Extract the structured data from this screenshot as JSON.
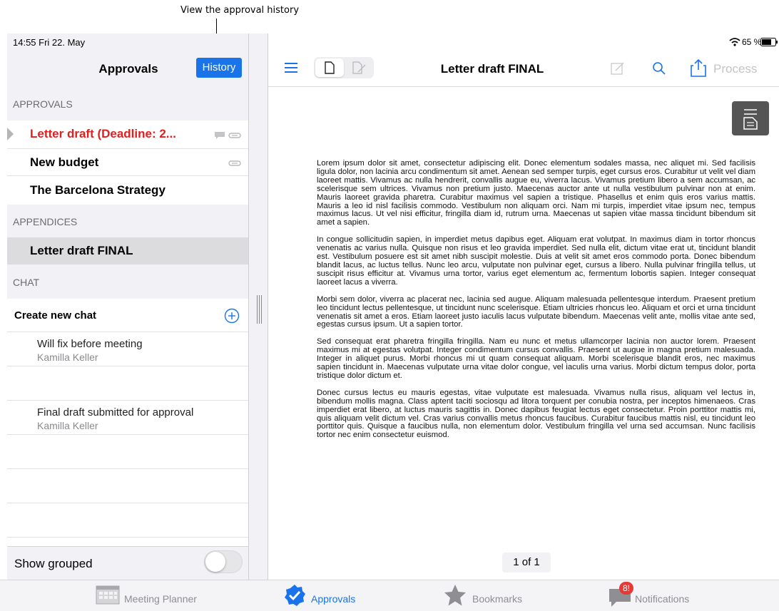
{
  "callout": {
    "text": "View the approval history"
  },
  "status": {
    "time_date": "14:55  Fri 22. May",
    "battery": "65 %"
  },
  "left": {
    "title": "Approvals",
    "history_label": "History",
    "approvals_header": "APPROVALS",
    "approvals": [
      {
        "label": "Letter draft (Deadline: 2...",
        "color": "#e02020"
      },
      {
        "label": "New budget"
      },
      {
        "label": "The Barcelona Strategy"
      }
    ],
    "appendices_header": "APPENDICES",
    "appendices": [
      {
        "label": "Letter draft FINAL"
      }
    ],
    "chat_header": "CHAT",
    "create_chat_label": "Create new chat",
    "chats": [
      {
        "title": "Will fix before meeting",
        "author": "Kamilla Keller"
      },
      {
        "title": "Final draft submitted for approval",
        "author": "Kamilla Keller"
      }
    ],
    "show_grouped_label": "Show grouped",
    "show_grouped": false
  },
  "right": {
    "doc_title": "Letter draft FINAL",
    "process_label": "Process",
    "page_indicator": "1 of 1",
    "paragraphs": [
      "Lorem ipsum dolor sit amet, consectetur adipiscing elit. Donec elementum sodales massa, nec aliquet mi. Sed facilisis ligula dolor, non lacinia arcu condimentum sit amet. Aenean sed semper turpis, eget cursus eros. Curabitur ut velit vel diam laoreet mattis. Vivamus ac nulla hendrerit, convallis augue eu, viverra lacus. Vivamus pretium libero a sem accumsan, ac scelerisque sem ultrices. Vivamus non pretium justo. Maecenas auctor ante ut nulla vestibulum pulvinar non at enim. Mauris laoreet gravida pharetra. Curabitur maximus vel sapien a tristique. Phasellus et enim quis eros varius mattis. Mauris a leo id nisl facilisis commodo. Vestibulum non aliquam orci. Nam mi turpis, imperdiet vitae ipsum nec, tempus maximus lacus. Ut vel nisi efficitur, fringilla diam id, rutrum urna. Maecenas ut sapien vitae massa tincidunt bibendum sit amet a sapien.",
      "In congue sollicitudin sapien, in imperdiet metus dapibus eget. Aliquam erat volutpat. In maximus diam in tortor rhoncus venenatis ac varius nulla. Quisque non risus et leo gravida imperdiet. Sed nulla elit, dictum vitae erat ut, tincidunt blandit est. Vestibulum posuere est sit amet nibh suscipit molestie. Duis at velit sit amet eros commodo porta. Donec bibendum blandit lacus, ac luctus tellus. Nunc leo arcu, vulputate non pulvinar eget, cursus a libero. Nulla pulvinar fringilla tellus, ut suscipit risus efficitur at. Vivamus urna tortor, varius eget elementum ac, fermentum lobortis sapien. Integer consequat laoreet lacus a viverra.",
      "Morbi sem dolor, viverra ac placerat nec, lacinia sed augue. Aliquam malesuada pellentesque interdum. Praesent pretium leo tincidunt lectus pellentesque, ut tincidunt nunc scelerisque. Etiam ultricies rhoncus leo. Aliquam et orci et urna tincidunt venenatis sit amet a eros. Etiam laoreet justo iaculis lacus vulputate bibendum. Maecenas velit ante, mollis vitae ante sed, egestas cursus ipsum. Ut a sapien tortor.",
      "Sed consequat erat pharetra fringilla fringilla. Nam eu nunc et metus ullamcorper lacinia non auctor lorem. Praesent maximus mi at egestas volutpat. Integer condimentum cursus convallis. Praesent ut augue in magna pretium malesuada. Integer in aliquet purus. Morbi rhoncus mi ut quam consequat aliquam. Morbi scelerisque blandit eros, nec maximus sapien tincidunt in. Maecenas vulputate urna vitae dolor congue, vel iaculis urna varius. Morbi dictum tempus dolor, porta tristique dolor dictum et.",
      "Donec cursus lectus eu mauris egestas, vitae vulputate est malesuada. Vivamus nulla risus, aliquam vel lectus in, bibendum mollis magna. Class aptent taciti sociosqu ad litora torquent per conubia nostra, per inceptos himenaeos. Cras imperdiet erat libero, at luctus mauris sagittis in. Donec dapibus feugiat lectus eget consectetur. Proin porttitor mattis mi, quis aliquam velit dictum vel. Cras varius convallis metus rhoncus faucibus. Curabitur faucibus mattis nisl, eu tincidunt leo porttitor quis. Quisque a faucibus nulla, non elementum dolor. Vestibulum fringilla vel urna sed accumsan. Nunc facilisis tortor nec enim consectetur euismod."
    ]
  },
  "tabs": [
    {
      "label": "Meeting Planner",
      "icon": "calendar-icon",
      "active": false
    },
    {
      "label": "Approvals",
      "icon": "approvals-check-icon",
      "active": true
    },
    {
      "label": "Bookmarks",
      "icon": "star-icon",
      "active": false
    },
    {
      "label": "Notifications",
      "icon": "chat-bubble-icon",
      "active": false,
      "badge": "8!"
    }
  ],
  "colors": {
    "accent": "#1a73e8",
    "deadline": "#e02020",
    "badge": "#e53935"
  }
}
